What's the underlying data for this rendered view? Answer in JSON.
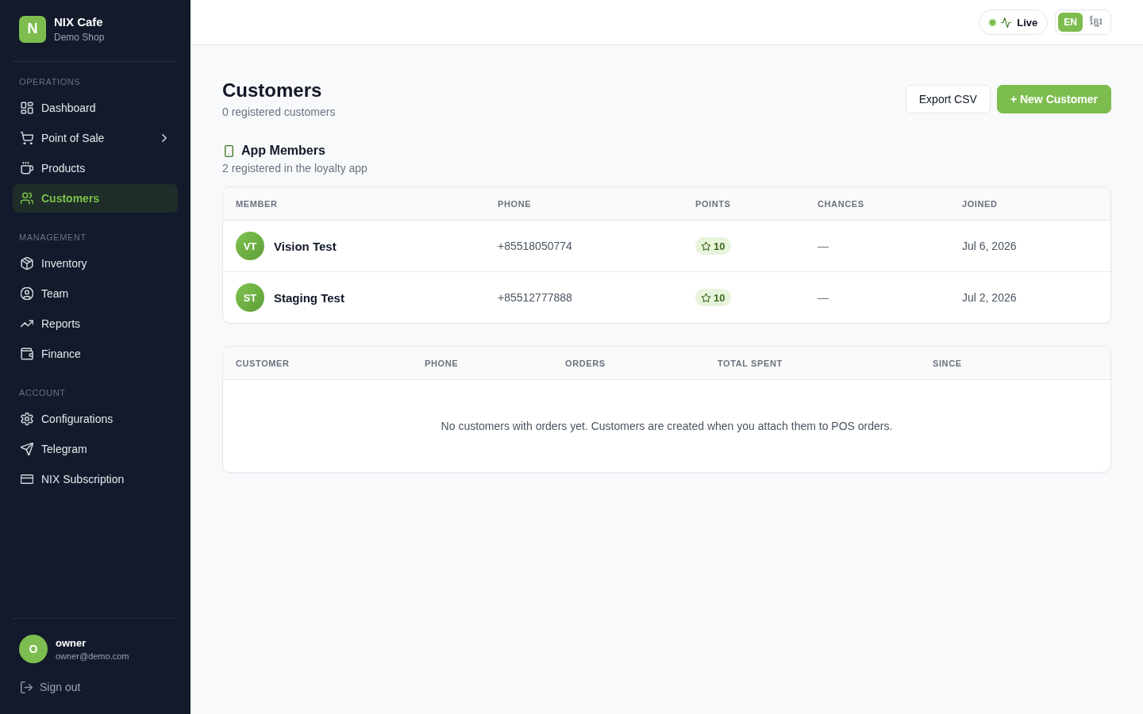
{
  "sidebar": {
    "brand": {
      "logo": "N",
      "name": "NIX Cafe",
      "subtitle": "Demo Shop"
    },
    "sections": [
      {
        "title": "OPERATIONS",
        "items": [
          {
            "label": "Dashboard",
            "kind": "link",
            "selected": false
          },
          {
            "label": "Point of Sale",
            "kind": "submenu",
            "selected": false
          },
          {
            "label": "Products",
            "kind": "link",
            "selected": false
          },
          {
            "label": "Customers",
            "kind": "link",
            "selected": true
          }
        ]
      },
      {
        "title": "MANAGEMENT",
        "items": [
          {
            "label": "Inventory",
            "kind": "link",
            "selected": false
          },
          {
            "label": "Team",
            "kind": "link",
            "selected": false
          },
          {
            "label": "Reports",
            "kind": "link",
            "selected": false
          },
          {
            "label": "Finance",
            "kind": "link",
            "selected": false
          }
        ]
      },
      {
        "title": "ACCOUNT",
        "items": [
          {
            "label": "Configurations",
            "kind": "link",
            "selected": false
          },
          {
            "label": "Telegram",
            "kind": "link",
            "selected": false
          },
          {
            "label": "NIX Subscription",
            "kind": "link",
            "selected": false
          }
        ]
      }
    ],
    "user": {
      "initial": "O",
      "name": "owner",
      "email": "owner@demo.com"
    },
    "sign_out": "Sign out"
  },
  "top_bar": {
    "live": {
      "label": "Live",
      "on": true
    },
    "languages": [
      {
        "label": "EN",
        "selected": true
      },
      {
        "label": "ខ្មែរ",
        "selected": false
      }
    ]
  },
  "page": {
    "title": "Customers",
    "subtitle": "0 registered customers",
    "buttons": [
      {
        "label": "Export CSV",
        "kind": "secondary"
      },
      {
        "label": "+ New Customer",
        "kind": "primary"
      }
    ]
  },
  "app_members": {
    "title": "App Members",
    "subtitle": "2 registered in the loyalty app",
    "table": {
      "columns": [
        "MEMBER",
        "PHONE",
        "POINTS",
        "CHANCES",
        "JOINED"
      ],
      "rows": [
        {
          "initials": "VT",
          "name": "Vision Test",
          "phone": "+85518050774",
          "points": "10",
          "chances": "—",
          "joined": "Jul 6, 2026"
        },
        {
          "initials": "ST",
          "name": "Staging Test",
          "phone": "+85512777888",
          "points": "10",
          "chances": "—",
          "joined": "Jul 2, 2026"
        }
      ]
    }
  },
  "customers_table": {
    "columns": [
      "CUSTOMER",
      "PHONE",
      "ORDERS",
      "TOTAL SPENT",
      "SINCE"
    ],
    "empty_message": "No customers with orders yet. Customers are created when you attach them to POS orders."
  }
}
